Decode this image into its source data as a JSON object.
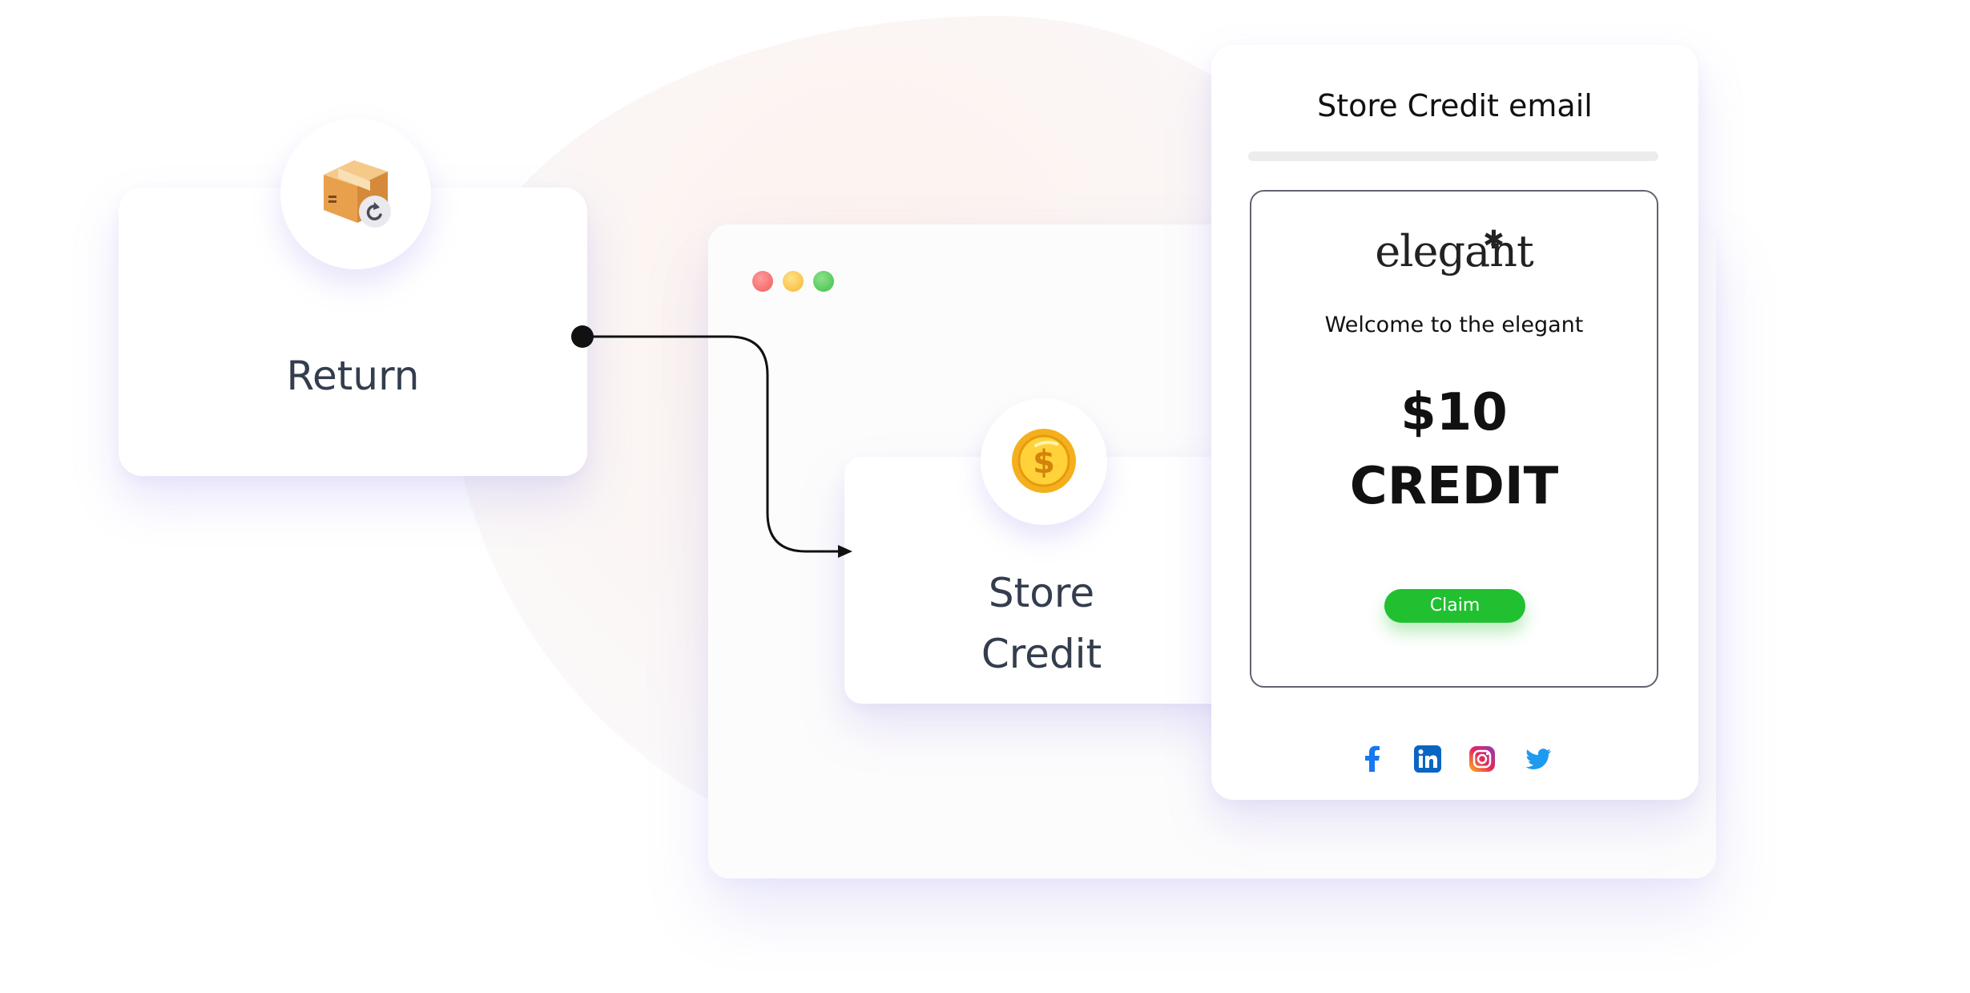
{
  "return_card": {
    "label": "Return",
    "icon": "return-box-icon"
  },
  "browser_window": {
    "controls": [
      "close-dot",
      "minimize-dot",
      "maximize-dot"
    ],
    "colors": {
      "close": "#f25c5c",
      "minimize": "#f7b731",
      "maximize": "#3cc24a"
    }
  },
  "store_credit_card": {
    "label_line1": "Store",
    "label_line2": "Credit",
    "icon": "dollar-coin-icon"
  },
  "email": {
    "title": "Store Credit email",
    "brand": "elegant",
    "welcome": "Welcome to the elegant",
    "amount": "$10",
    "credit_word": "CREDIT",
    "claim_label": "Claim",
    "social_icons": [
      "facebook-icon",
      "linkedin-icon",
      "instagram-icon",
      "twitter-icon"
    ]
  },
  "colors": {
    "text_primary": "#333d4d",
    "claim_button": "#20c030",
    "facebook": "#1877f2",
    "linkedin": "#0a66c2",
    "twitter": "#1d9bf0"
  }
}
